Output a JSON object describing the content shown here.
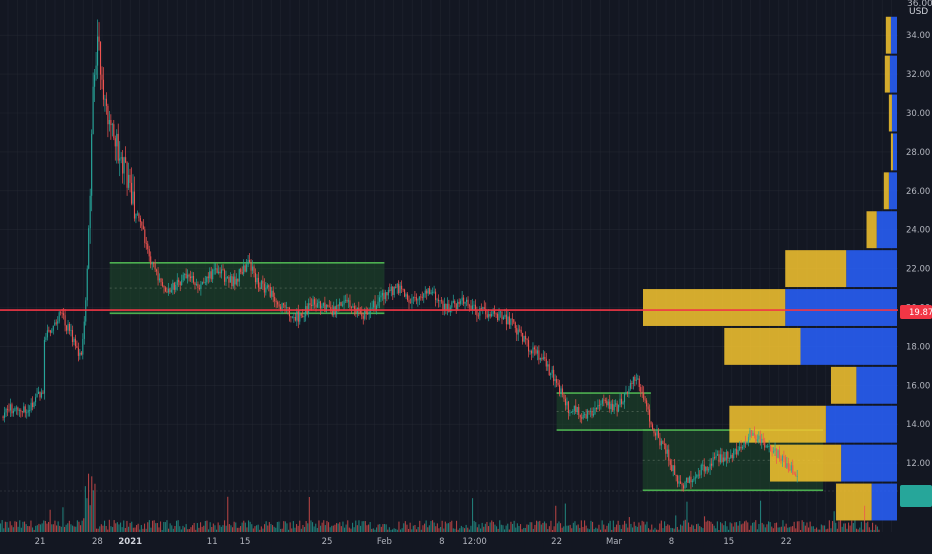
{
  "chart_data": {
    "type": "line",
    "title": "",
    "xlabel": "",
    "ylabel": "",
    "ylim": [
      9.9,
      36.0
    ],
    "y_ticks": [
      "34.00",
      "32.00",
      "30.00",
      "28.00",
      "26.00",
      "24.00",
      "22.00",
      "20.00",
      "18.00",
      "16.00",
      "14.00",
      "12.00"
    ],
    "x_ticks": [
      {
        "label": "21",
        "x": 0
      },
      {
        "label": "28",
        "x": 7
      },
      {
        "label": "2021",
        "x": 11
      },
      {
        "label": "11",
        "x": 21
      },
      {
        "label": "15",
        "x": 25
      },
      {
        "label": "25",
        "x": 35
      },
      {
        "label": "Feb",
        "x": 42
      },
      {
        "label": "8",
        "x": 49
      },
      {
        "label": "12:00",
        "x": 53
      },
      {
        "label": "22",
        "x": 63
      },
      {
        "label": "Mar",
        "x": 70
      },
      {
        "label": "8",
        "x": 77
      },
      {
        "label": "15",
        "x": 84
      },
      {
        "label": "22",
        "x": 91
      }
    ],
    "x_range": [
      -4.5,
      107
    ],
    "currency_label": "USD",
    "top_price_label": "36.00",
    "current_price": {
      "label": "19.87",
      "value": 19.87
    },
    "price_series": {
      "x": [
        -4.5,
        -3.5,
        -2.5,
        -1.5,
        -0.5,
        0.5,
        0.5,
        1.5,
        2.5,
        3.5,
        4.5,
        5.0,
        5.5,
        6.0,
        6.5,
        7.0,
        7.5,
        8.0,
        8.5,
        9.5,
        10.5,
        11.5,
        12.5,
        13.5,
        15.5,
        17.5,
        19.5,
        21.5,
        23.5,
        25.5,
        26.5,
        27.5,
        29.5,
        31.5,
        33.5,
        35.5,
        37.5,
        39.5,
        41.5,
        43.5,
        45.5,
        47.5,
        49.5,
        51.5,
        53.5,
        55.5,
        57.5,
        59.5,
        61.5,
        62.5,
        64.5,
        66.5,
        68.5,
        70.5,
        72.5,
        73.5,
        74.5,
        75.5,
        76.5,
        77.5,
        78.5,
        80.5,
        82.5,
        84.5,
        86.5,
        88.5,
        90.5,
        92.5
      ],
      "y": [
        14.4,
        14.8,
        14.6,
        14.9,
        15.3,
        15.6,
        18.5,
        19.0,
        19.6,
        18.9,
        17.8,
        17.6,
        19.6,
        24.5,
        31.0,
        34.0,
        32.2,
        30.5,
        29.6,
        28.0,
        26.8,
        25.2,
        24.0,
        22.3,
        20.9,
        21.5,
        21.2,
        21.9,
        21.3,
        22.3,
        21.3,
        21.0,
        20.0,
        19.5,
        20.3,
        19.7,
        20.3,
        19.6,
        20.4,
        21.0,
        20.3,
        20.8,
        19.9,
        20.3,
        19.8,
        19.7,
        19.2,
        18.0,
        17.2,
        16.5,
        14.8,
        14.5,
        15.0,
        14.9,
        16.5,
        15.5,
        14.0,
        13.2,
        12.5,
        11.3,
        10.9,
        11.6,
        12.2,
        12.4,
        13.5,
        12.9,
        12.2,
        11.2
      ]
    },
    "horizontal_lines": [
      {
        "value": 19.87,
        "color": "#f23645"
      }
    ],
    "zones": [
      {
        "x": [
          8.5,
          42
        ],
        "y": [
          19.7,
          22.3
        ]
      },
      {
        "x": [
          63,
          74.5
        ],
        "y": [
          13.7,
          15.6
        ]
      },
      {
        "x": [
          73.5,
          95.5
        ],
        "y": [
          10.6,
          13.7
        ]
      }
    ],
    "volume_profile": [
      {
        "price": 34.0,
        "up": 0.6,
        "down": 0.5
      },
      {
        "price": 32.0,
        "up": 0.7,
        "down": 0.5
      },
      {
        "price": 30.0,
        "up": 0.5,
        "down": 0.3
      },
      {
        "price": 28.0,
        "up": 0.4,
        "down": 0.2
      },
      {
        "price": 26.0,
        "up": 0.8,
        "down": 0.5
      },
      {
        "price": 24.0,
        "up": 2.0,
        "down": 1.0
      },
      {
        "price": 22.0,
        "up": 5.0,
        "down": 6.0
      },
      {
        "price": 20.0,
        "up": 11.0,
        "down": 14.0
      },
      {
        "price": 18.0,
        "up": 9.5,
        "down": 7.5
      },
      {
        "price": 16.0,
        "up": 4.0,
        "down": 2.5
      },
      {
        "price": 14.0,
        "up": 7.0,
        "down": 9.5
      },
      {
        "price": 12.0,
        "up": 5.5,
        "down": 7.0
      },
      {
        "price": 10.0,
        "up": 2.5,
        "down": 3.5
      }
    ],
    "volume_histogram": {
      "color_up": "#26a69a",
      "color_down": "#ef5350"
    },
    "colors": {
      "background": "#131722",
      "grid": "#2a2e39",
      "candle_up": "#26a69a",
      "candle_down": "#ef5350",
      "zone_border": "#4caf50",
      "zone_fill": "#1e4a2a",
      "profile_up": "#2962ff",
      "profile_down": "#f7c62f",
      "price_line": "#f23645",
      "axis_text": "#b2b5be",
      "last_price_badge": "#26a69a"
    }
  }
}
